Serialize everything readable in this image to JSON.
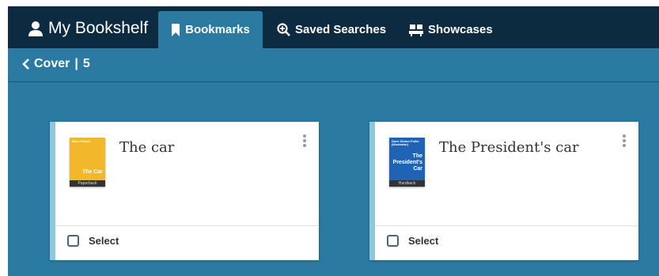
{
  "header": {
    "brand_label": "My Bookshelf",
    "tabs": [
      {
        "label": "Bookmarks",
        "icon": "bookmark-icon",
        "active": true
      },
      {
        "label": "Saved Searches",
        "icon": "search-plus-icon",
        "active": false
      },
      {
        "label": "Showcases",
        "icon": "showcase-icon",
        "active": false
      }
    ]
  },
  "breadcrumb": {
    "label": "Cover",
    "separator": "|",
    "count": "5"
  },
  "cards": [
    {
      "title": "The car",
      "cover": {
        "publisher": "Dave Parker",
        "title_line1": "The Car",
        "format": "Paperback",
        "color": "#f2b82b"
      },
      "select_label": "Select"
    },
    {
      "title": "The President's car",
      "cover": {
        "publisher": "Dave Simon Fuller (Illustrator)",
        "title_line1": "The President's Car",
        "format": "Hardback",
        "color": "#1f63b5"
      },
      "select_label": "Select"
    }
  ],
  "colors": {
    "topbar": "#0c2b41",
    "background": "#2a7aa1",
    "card_accent": "#8fc6d9"
  }
}
